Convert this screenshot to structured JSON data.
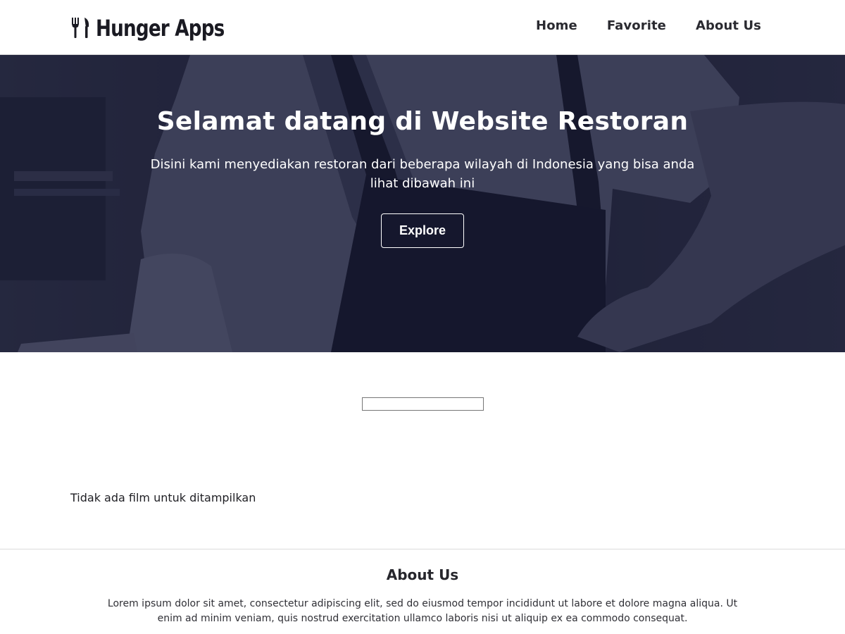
{
  "header": {
    "brand": "Hunger Apps",
    "brand_icon": "fork-knife-icon",
    "nav": [
      {
        "label": "Home"
      },
      {
        "label": "Favorite"
      },
      {
        "label": "About Us"
      }
    ]
  },
  "hero": {
    "title": "Selamat datang di Website Restoran",
    "subtitle": "Disini kami menyediakan restoran dari beberapa wilayah di Indonesia yang bisa anda lihat dibawah ini",
    "button_label": "Explore",
    "overlay_color": "#1d2034"
  },
  "main": {
    "search": {
      "value": "",
      "placeholder": ""
    },
    "empty_message": "Tidak ada film untuk ditampilkan"
  },
  "footer": {
    "title": "About Us",
    "text": "Lorem ipsum dolor sit amet, consectetur adipiscing elit, sed do eiusmod tempor incididunt ut labore et dolore magna aliqua. Ut enim ad minim veniam, quis nostrud exercitation ullamco laboris nisi ut aliquip ex ea commodo consequat."
  }
}
